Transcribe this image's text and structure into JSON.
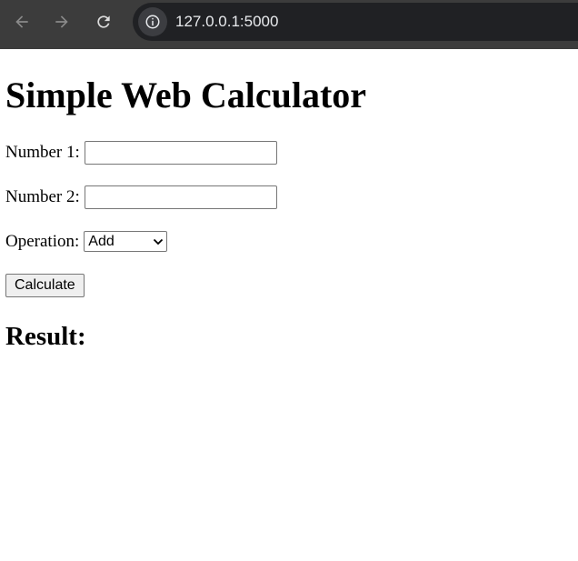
{
  "browser": {
    "url": "127.0.0.1:5000",
    "back_icon": "arrow-left-icon",
    "forward_icon": "arrow-right-icon",
    "reload_icon": "reload-icon",
    "info_icon": "info-icon"
  },
  "page": {
    "title": "Simple Web Calculator",
    "form": {
      "number1_label": "Number 1:",
      "number1_value": "",
      "number2_label": "Number 2:",
      "number2_value": "",
      "operation_label": "Operation:",
      "operation_selected": "Add",
      "calculate_label": "Calculate"
    },
    "result_heading": "Result:"
  },
  "colors": {
    "chrome_bg": "#3c3c3c",
    "omnibox_bg": "#202124",
    "url_text": "#e8eaed"
  }
}
